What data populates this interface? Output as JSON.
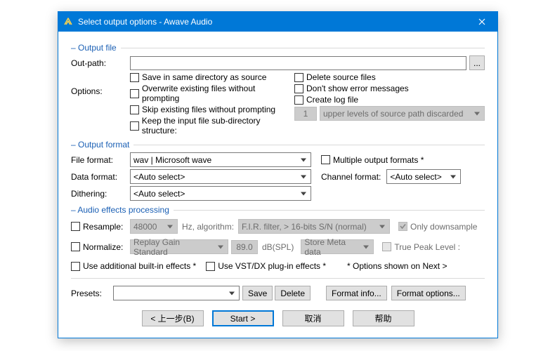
{
  "window": {
    "title": "Select output options - Awave Audio"
  },
  "groups": {
    "output_file": "Output file",
    "output_format": "Output format",
    "audio_fx": "Audio effects processing"
  },
  "out_path": {
    "label": "Out-path:",
    "value": "",
    "browse": "..."
  },
  "options": {
    "label": "Options:",
    "left": {
      "save_same_dir": "Save in same directory as source",
      "overwrite": "Overwrite existing files without prompting",
      "skip_existing": "Skip existing files without prompting",
      "keep_subdir": "Keep the input file sub-directory structure:"
    },
    "right": {
      "delete_source": "Delete source files",
      "no_errors": "Don't show error messages",
      "create_log": "Create log file"
    },
    "subdir_levels": "1",
    "subdir_levels_label": "upper levels of source path discarded"
  },
  "format": {
    "file_label": "File format:",
    "file_value": "wav | Microsoft wave",
    "data_label": "Data format:",
    "data_value": "<Auto select>",
    "dither_label": "Dithering:",
    "dither_value": "<Auto select>",
    "multi_label": "Multiple output formats *",
    "channel_label": "Channel format:",
    "channel_value": "<Auto select>"
  },
  "fx": {
    "resample_label": "Resample:",
    "resample_rate": "48000",
    "hz_alg_label": "Hz, algorithm:",
    "resample_alg": "F.I.R. filter, > 16-bits S/N (normal)",
    "only_down": "Only downsample",
    "normalize_label": "Normalize:",
    "normalize_mode": "Replay Gain Standard",
    "normalize_db": "89.0",
    "db_unit": "dB(SPL)",
    "meta": "Store Meta data",
    "true_peak": "True Peak Level :",
    "builtin": "Use additional built-in effects *",
    "vstdx": "Use VST/DX plug-in effects *",
    "note": "* Options shown on Next >"
  },
  "presets": {
    "label": "Presets:",
    "value": "",
    "save": "Save",
    "delete": "Delete",
    "format_info": "Format info...",
    "format_options": "Format options..."
  },
  "footer": {
    "back": "< 上一步(B)",
    "start": "Start >",
    "cancel": "取消",
    "help": "帮助"
  }
}
